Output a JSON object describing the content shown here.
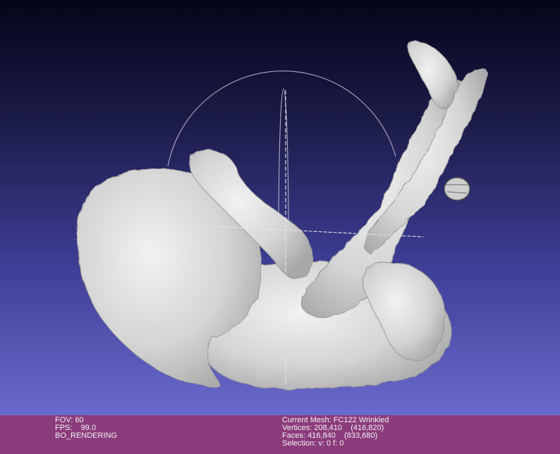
{
  "viewport": {
    "mesh_name": "FC122 Wrinkled"
  },
  "status": {
    "fov": "FOV: 60",
    "fps_label": "FPS:",
    "fps_value": "99.0",
    "render_mode": "BO_RENDERING",
    "current_mesh": "Current Mesh: FC122 Wrinkled",
    "vertices": "Vertices: 208,410    (416,820)",
    "faces": "Faces: 416,840    (833,680)",
    "selection": "Selection: v: 0 f: 0"
  },
  "colors": {
    "status_bar": "#8b3c7c",
    "mesh": "#d8d8d8",
    "trackball": "#c8c8d8"
  }
}
